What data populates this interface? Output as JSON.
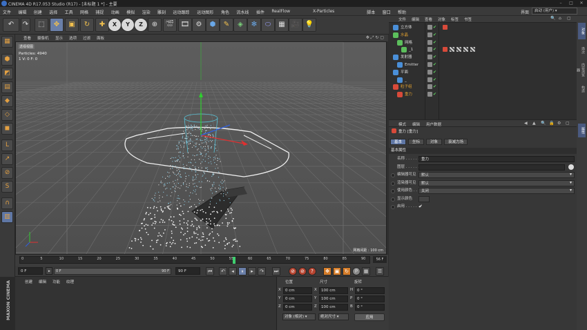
{
  "window": {
    "title": "CINEMA 4D R17.053 Studio (R17) - [未标题 1 *] - 主要"
  },
  "menu": [
    "文件",
    "编辑",
    "创建",
    "选择",
    "工具",
    "网格",
    "捕捉",
    "动画",
    "模拟",
    "渲染",
    "雕刻",
    "运动跟踪",
    "运动图形",
    "角色",
    "流水线",
    "插件",
    "RealFlow",
    "X-Particles",
    "脚本",
    "窗口",
    "帮助"
  ],
  "layout": {
    "label": "界面",
    "value": "启动 (用户)"
  },
  "viewport": {
    "menu": [
      "查看",
      "摄像机",
      "显示",
      "选项",
      "过滤",
      "面板"
    ],
    "label": "透视视图",
    "particles": "Particles: 4940",
    "stats": "1 V: 0 F: 0",
    "grid_spacing": "网格间距 : 100 cm"
  },
  "timeline": {
    "ticks": [
      "0",
      "5",
      "10",
      "15",
      "20",
      "25",
      "30",
      "35",
      "40",
      "45",
      "50",
      "55",
      "60",
      "65",
      "70",
      "75",
      "80",
      "85",
      "90"
    ],
    "current": "56 F",
    "current_frame": 56,
    "max_frame": 90
  },
  "playback": {
    "start": "0 F",
    "preview_start": "0 F",
    "preview_end": "90 F",
    "end": "90 F"
  },
  "material_menu": [
    "创建",
    "编辑",
    "功能",
    "纹理"
  ],
  "maxon": "MAXON CINEMA 4D",
  "coords": {
    "headers": [
      "位置",
      "尺寸",
      "旋转"
    ],
    "rows": [
      {
        "axis": "X",
        "pos": "0 cm",
        "size_axis": "X",
        "size": "100 cm",
        "rot_axis": "H",
        "rot": "0 °"
      },
      {
        "axis": "Y",
        "pos": "0 cm",
        "size_axis": "Y",
        "size": "100 cm",
        "rot_axis": "P",
        "rot": "0 °"
      },
      {
        "axis": "Z",
        "pos": "0 cm",
        "size_axis": "Z",
        "size": "100 cm",
        "rot_axis": "B",
        "rot": "0 °"
      }
    ],
    "mode": "对象 (相对)",
    "size_mode": "绝对尺寸",
    "apply": "应用"
  },
  "object_manager": {
    "menu": [
      "文件",
      "编辑",
      "查看",
      "对象",
      "标签",
      "书签"
    ],
    "objects": [
      {
        "name": "立方体",
        "indent": 0,
        "icon": "#4a8fd8",
        "color": "#d8d8d8"
      },
      {
        "name": "水晶",
        "indent": 0,
        "icon": "#5cbf5c",
        "color": "#e0a030"
      },
      {
        "name": "网格",
        "indent": 1,
        "icon": "#5cbf5c",
        "color": "#d8d8d8"
      },
      {
        "name": "_1",
        "indent": 2,
        "icon": "#5cbf5c",
        "color": "#d8d8d8"
      },
      {
        "name": "发射器",
        "indent": 0,
        "icon": "#4a8fd8",
        "color": "#d8d8d8"
      },
      {
        "name": "Emitter",
        "indent": 1,
        "icon": "#4a8fd8",
        "color": "#d8d8d8"
      },
      {
        "name": "平面",
        "indent": 0,
        "icon": "#4a8fd8",
        "color": "#d8d8d8"
      },
      {
        "name": "_",
        "indent": 1,
        "icon": "#4a8fd8",
        "color": "#d8d8d8"
      },
      {
        "name": "粒子组",
        "indent": 0,
        "icon": "#d84a3a",
        "color": "#e0a030"
      },
      {
        "name": "重力",
        "indent": 1,
        "icon": "#d84a3a",
        "color": "#e0a030"
      }
    ],
    "side_tabs": [
      "对象",
      "场次",
      "内容浏览器",
      "构造"
    ]
  },
  "attributes": {
    "menu": [
      "模式",
      "编辑",
      "用户数据"
    ],
    "object": "重力 [重力]",
    "tabs": [
      "基本",
      "坐标",
      "对象",
      "衰减力场"
    ],
    "active_tab": "基本",
    "section": "基本属性",
    "fields": [
      {
        "label": "名称 . . . . . . .",
        "value": "重力",
        "type": "text"
      },
      {
        "label": "图层 . . . . . . .",
        "value": "",
        "type": "text"
      },
      {
        "label": "编辑器可见",
        "value": "默认",
        "type": "drop"
      },
      {
        "label": "渲染器可见",
        "value": "默认",
        "type": "drop"
      },
      {
        "label": "使用颜色 . . .",
        "value": "关闭",
        "type": "drop"
      },
      {
        "label": "显示颜色",
        "value": "",
        "type": "color"
      },
      {
        "label": "启用 . . . . . . .",
        "value": "✔",
        "type": "check"
      }
    ],
    "side_tab": "属性"
  },
  "colors": {
    "accent": "#5f77a5",
    "viewport": "#555555",
    "panel": "#3a3a3a"
  }
}
